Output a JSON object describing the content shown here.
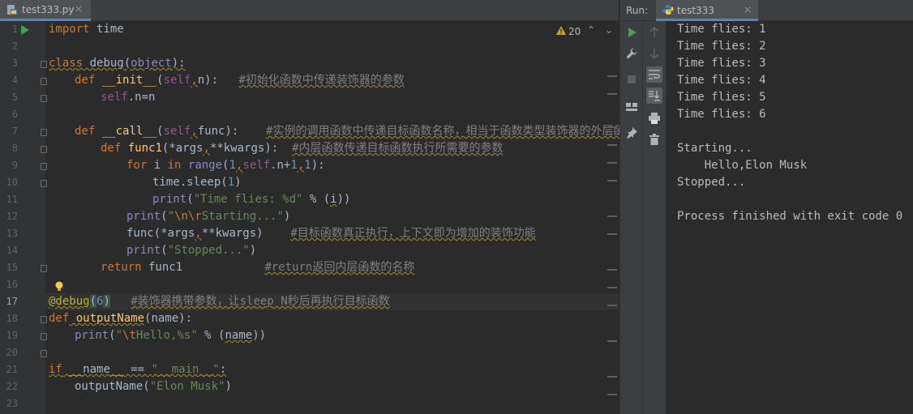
{
  "editor": {
    "tab": {
      "label": "test333.py",
      "close": "×"
    },
    "inspection": {
      "count": "20",
      "up": "⌃",
      "down": "⌄"
    },
    "line_numbers": [
      "1",
      "2",
      "3",
      "4",
      "5",
      "6",
      "7",
      "8",
      "9",
      "10",
      "11",
      "12",
      "13",
      "14",
      "15",
      "16",
      "17",
      "18",
      "19",
      "20",
      "21",
      "22",
      "23"
    ],
    "current_line": "17",
    "code": {
      "l1": {
        "kw": "import",
        "rest": " time"
      },
      "l3": {
        "kw": "class",
        "name": " debug",
        "open": "(",
        "base": "object",
        "close": "):"
      },
      "l4": {
        "kw": "def",
        "fn": " __init__",
        "p1": "(",
        "self": "self",
        "c": ",",
        "rest": "n):",
        "comment": "#初始化函数中传递装饰器的参数"
      },
      "l5": {
        "self": "self",
        "rest": ".n=n"
      },
      "l7": {
        "kw": "def",
        "fn": " __call__",
        "p1": "(",
        "self": "self",
        "c": ",",
        "rest": "func):",
        "comment": "#实例的调用函数中传递目标函数名称，相当于函数类型装饰器的外层函数"
      },
      "l8": {
        "kw": "def",
        "fn": " func1",
        "a": "(*args",
        "c": ",",
        "b": "**kwargs):",
        "comment": "#内层函数传递目标函数执行所需要的参数"
      },
      "l9": {
        "kw1": "for",
        "m1": " i ",
        "kw2": "in",
        "sp": " ",
        "bi": "range",
        "p": "(",
        "n1": "1",
        "c1": ",",
        "self": "self",
        "m2": ".n+",
        "n2": "1",
        "c2": ",",
        "n3": "1",
        "end": "):"
      },
      "l10": {
        "a": "time.sleep(",
        "n": "1",
        "b": ")"
      },
      "l11": {
        "bi": "print",
        "p": "(",
        "s": "\"Time flies: %d\"",
        "rest": " % (",
        "i": "i",
        "end": "))"
      },
      "l12": {
        "bi": "print",
        "p": "(",
        "q1": "\"",
        "e": "\\n\\r",
        "s": "Starting...\"",
        "end": ")"
      },
      "l13": {
        "a": "func(*args",
        "c": ",",
        "b": "**kwargs)",
        "comment": "#目标函数真正执行，上下文即为增加的装饰功能"
      },
      "l14": {
        "bi": "print",
        "p": "(",
        "s": "\"Stopped...\"",
        "end": ")"
      },
      "l15": {
        "kw": "return",
        "rest": " func1",
        "comment": "#return返回内层函数的名称"
      },
      "l17": {
        "dec": "@debug",
        "p": "(",
        "n": "6",
        "end": ")",
        "comment": "#装饰器携带参数，让sleep N秒后再执行目标函数"
      },
      "l18": {
        "kw": "def",
        "fn": " outputName",
        "rest": "(name):"
      },
      "l19": {
        "bi": "print",
        "p": "(",
        "q1": "\"",
        "e": "\\t",
        "s": "Hello,%s\"",
        "rest": " % (",
        "n": "name",
        "end": "))"
      },
      "l21": {
        "kw": "if",
        "sp": " ",
        "n": "__name__",
        "rest": " == ",
        "s": "\"__main__\"",
        "end": ":"
      },
      "l22": {
        "a": "outputName(",
        "s": "\"Elon Musk\"",
        "end": ")"
      }
    }
  },
  "run": {
    "label": "Run:",
    "tab": {
      "label": "test333",
      "close": "×"
    },
    "output": [
      "Time flies: 1",
      "Time flies: 2",
      "Time flies: 3",
      "Time flies: 4",
      "Time flies: 5",
      "Time flies: 6",
      "",
      "Starting...",
      "    Hello,Elon Musk",
      "Stopped...",
      "",
      "Process finished with exit code 0"
    ]
  },
  "colors": {
    "background": "#2b2b2b",
    "keyword": "#cc7832",
    "string": "#6a8759",
    "number": "#6897bb",
    "comment": "#808080",
    "function": "#ffc66d",
    "self": "#94558d",
    "decorator": "#bbb529",
    "run_green": "#499c54"
  }
}
